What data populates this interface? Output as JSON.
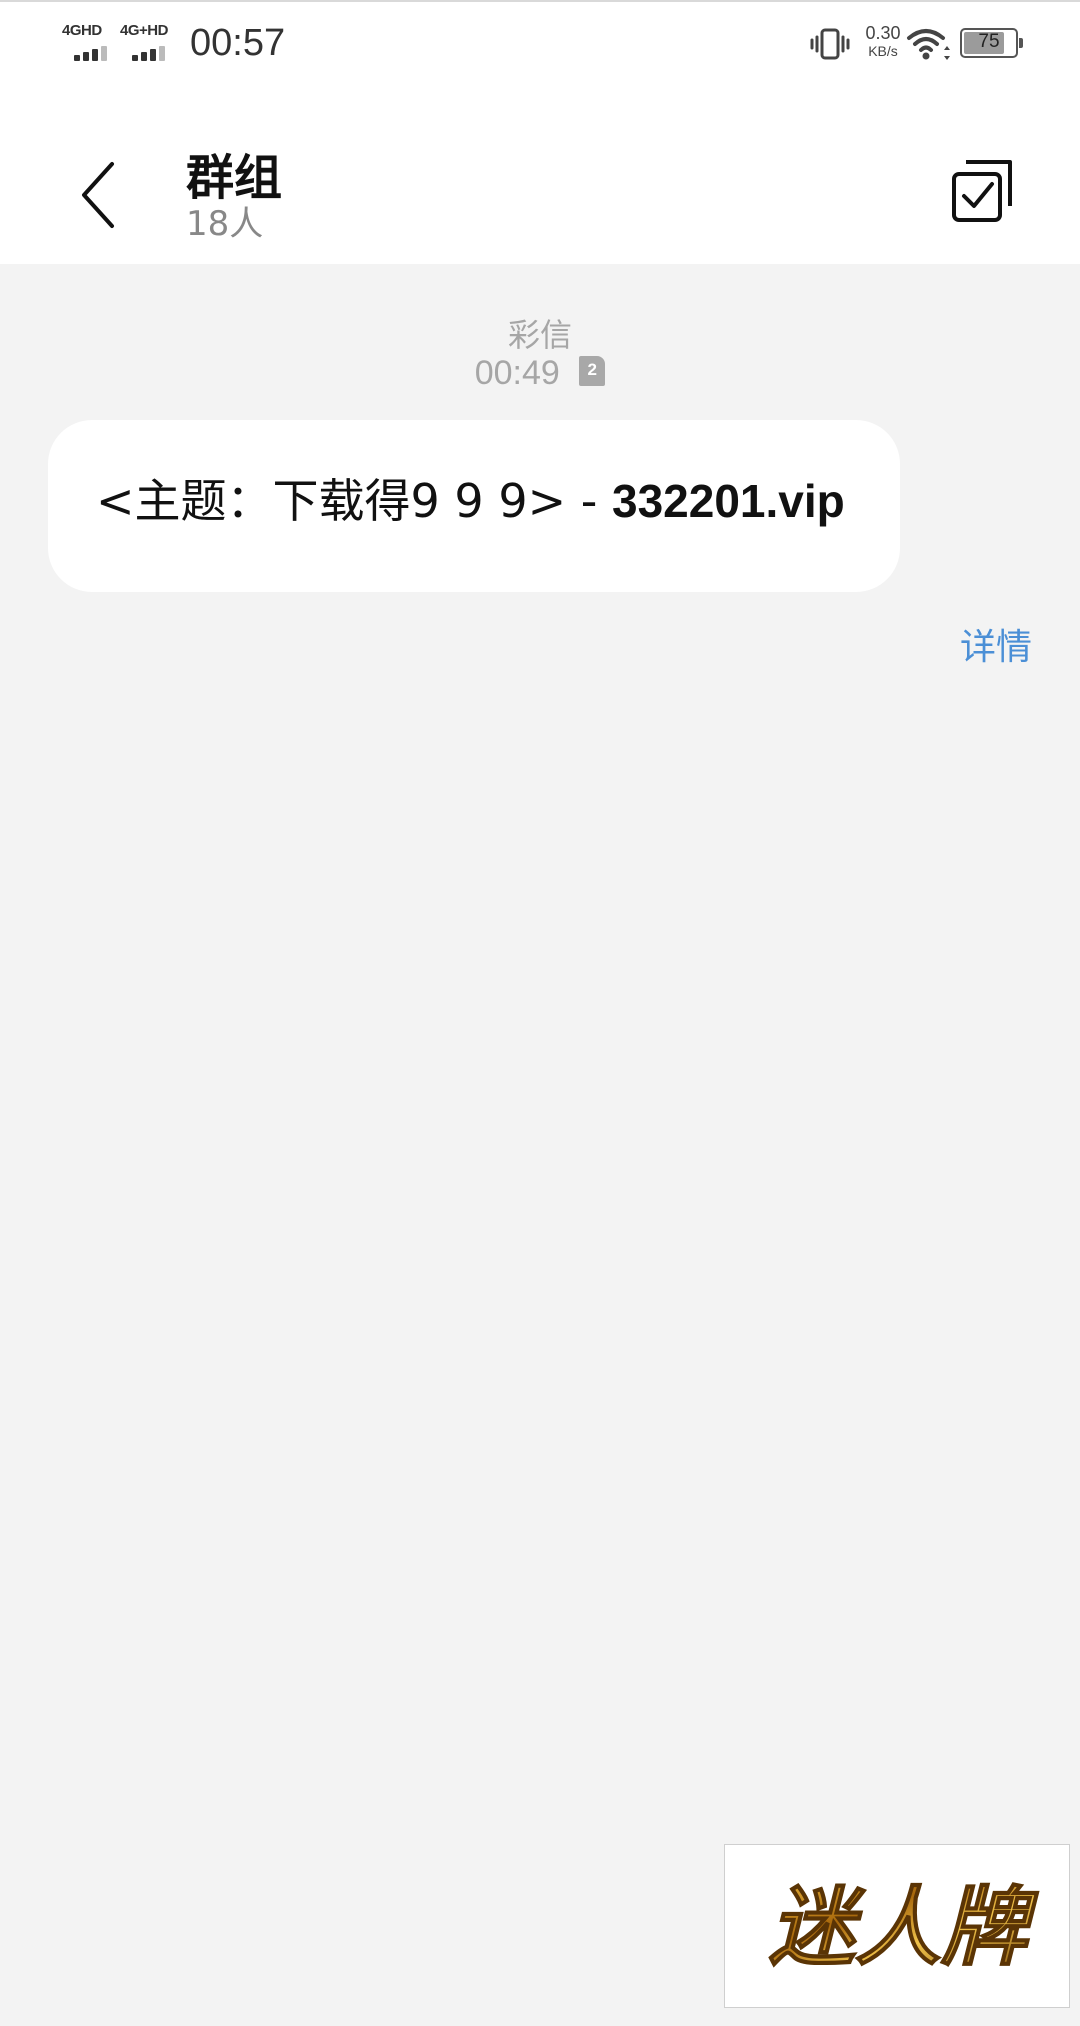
{
  "status_bar": {
    "sim1_network": "4GHD",
    "sim2_network": "4G+HD",
    "time": "00:57",
    "net_speed_value": "0.30",
    "net_speed_unit": "KB/s",
    "battery_level": "75",
    "icons": [
      "signal-icon",
      "vibrate-icon",
      "wifi-icon",
      "battery-icon"
    ]
  },
  "header": {
    "title": "群组",
    "subtitle": "18人",
    "back_icon": "chevron-left-icon",
    "select_icon": "multi-select-icon"
  },
  "conversation": {
    "message_type": "彩信",
    "timestamp": "00:49",
    "sim_slot": "2",
    "message": {
      "prefix": "<主题：下载得9 9 9> - ",
      "link": "332201.vip"
    },
    "details_label": "详情"
  },
  "watermark": {
    "text": "迷人牌",
    "colors": {
      "gold": "#c98a1a",
      "dark_gold": "#7a4a08"
    }
  },
  "colors": {
    "background": "#f3f3f3",
    "link_blue": "#4b8fd6",
    "muted_gray": "#a6a6a6"
  }
}
